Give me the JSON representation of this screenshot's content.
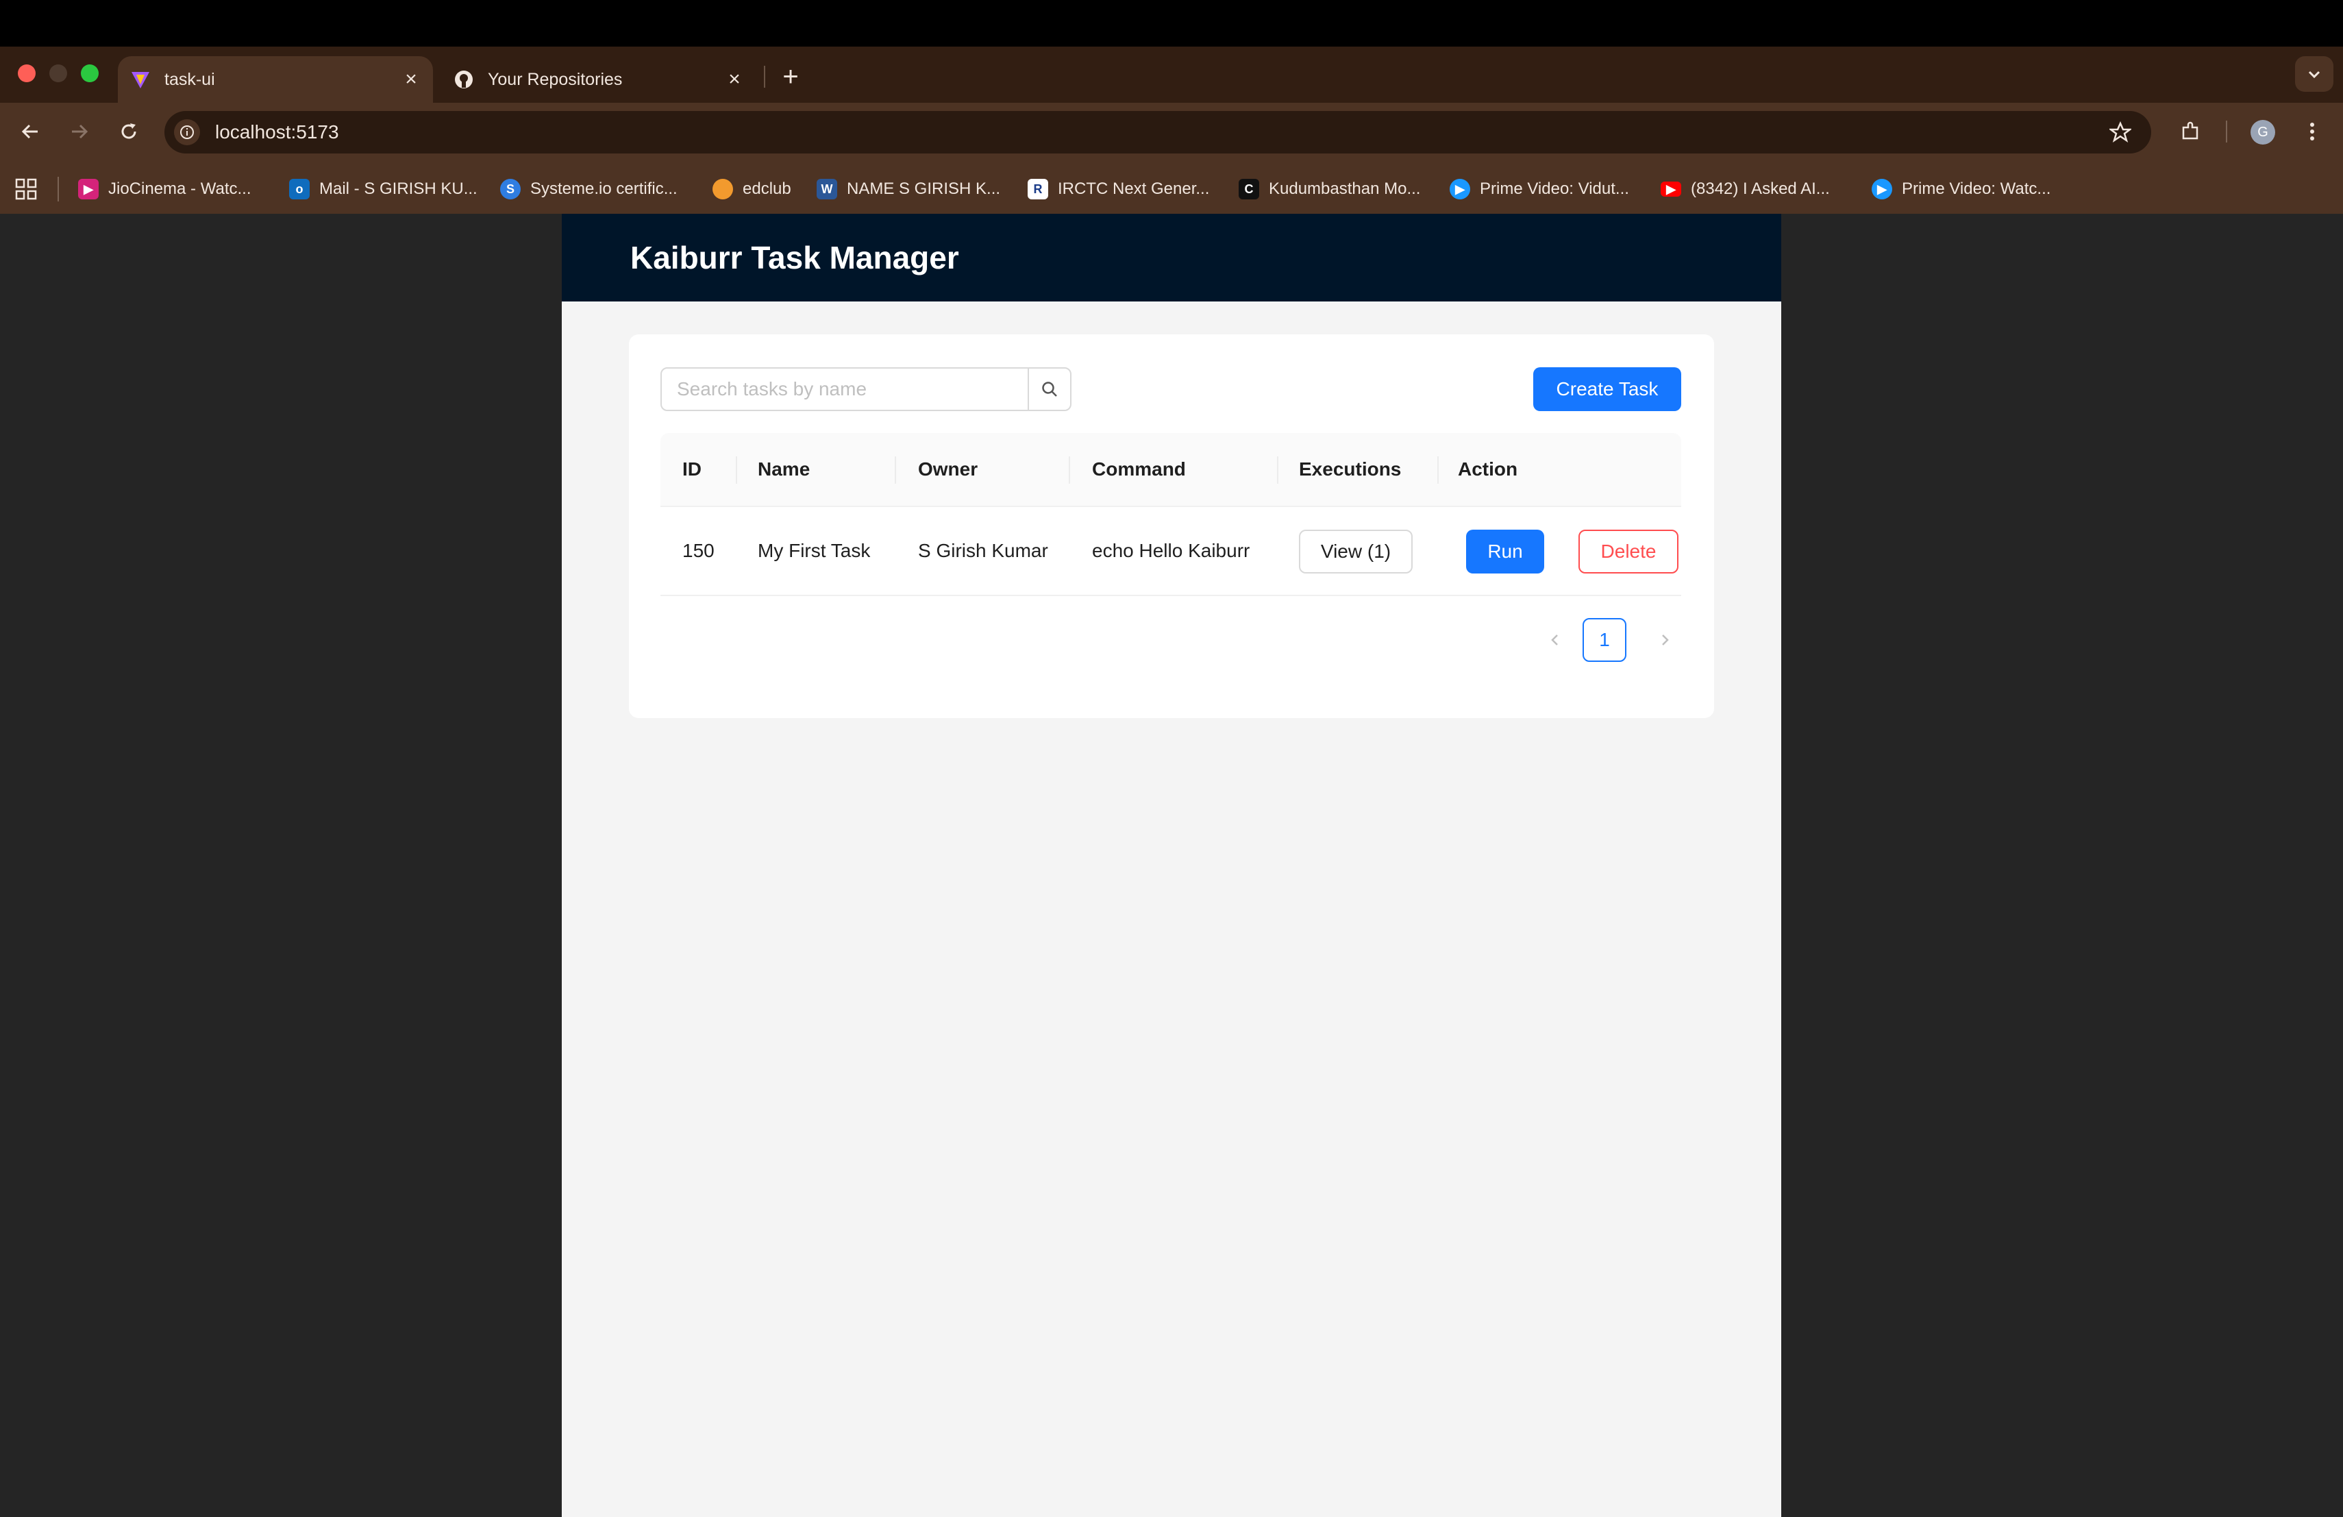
{
  "browser": {
    "tabs": [
      {
        "title": "task-ui",
        "icon": "vite-icon",
        "active": true
      },
      {
        "title": "Your Repositories",
        "icon": "github-icon",
        "active": false
      }
    ],
    "url": "localhost:5173",
    "profile_initial": "G",
    "bookmarks": [
      {
        "label": "JioCinema - Watc...",
        "icon": "jiocinema-icon",
        "color": "#d4237a"
      },
      {
        "label": "Mail - S GIRISH KU...",
        "icon": "outlook-icon",
        "color": "#0f6cbd"
      },
      {
        "label": "Systeme.io certific...",
        "icon": "systeme-icon",
        "color": "#2f7de1"
      },
      {
        "label": "edclub",
        "icon": "edclub-icon",
        "color": "#f29a2e"
      },
      {
        "label": "NAME S GIRISH K...",
        "icon": "word-icon",
        "color": "#2b5797"
      },
      {
        "label": "IRCTC Next Gener...",
        "icon": "irctc-icon",
        "color": "#ffffff"
      },
      {
        "label": "Kudumbasthan Mo...",
        "icon": "kudumbasthan-icon",
        "color": "#111111"
      },
      {
        "label": "Prime Video: Vidut...",
        "icon": "prime-video-icon",
        "color": "#1a98ff"
      },
      {
        "label": "(8342) I Asked AI...",
        "icon": "youtube-icon",
        "color": "#ff0000"
      },
      {
        "label": "Prime Video: Watc...",
        "icon": "prime-video-icon",
        "color": "#1a98ff"
      }
    ]
  },
  "app": {
    "title": "Kaiburr Task Manager",
    "search": {
      "placeholder": "Search tasks by name",
      "value": ""
    },
    "create_label": "Create Task",
    "columns": [
      "ID",
      "Name",
      "Owner",
      "Command",
      "Executions",
      "Action"
    ],
    "rows": [
      {
        "id": "150",
        "name": "My First Task",
        "owner": "S Girish Kumar",
        "command": "echo Hello Kaiburr",
        "executions_label": "View (1)",
        "run_label": "Run",
        "delete_label": "Delete"
      }
    ],
    "pagination": {
      "current": "1"
    },
    "colors": {
      "header_bg": "#001529",
      "primary": "#1677ff",
      "danger": "#ff4d4f"
    }
  }
}
